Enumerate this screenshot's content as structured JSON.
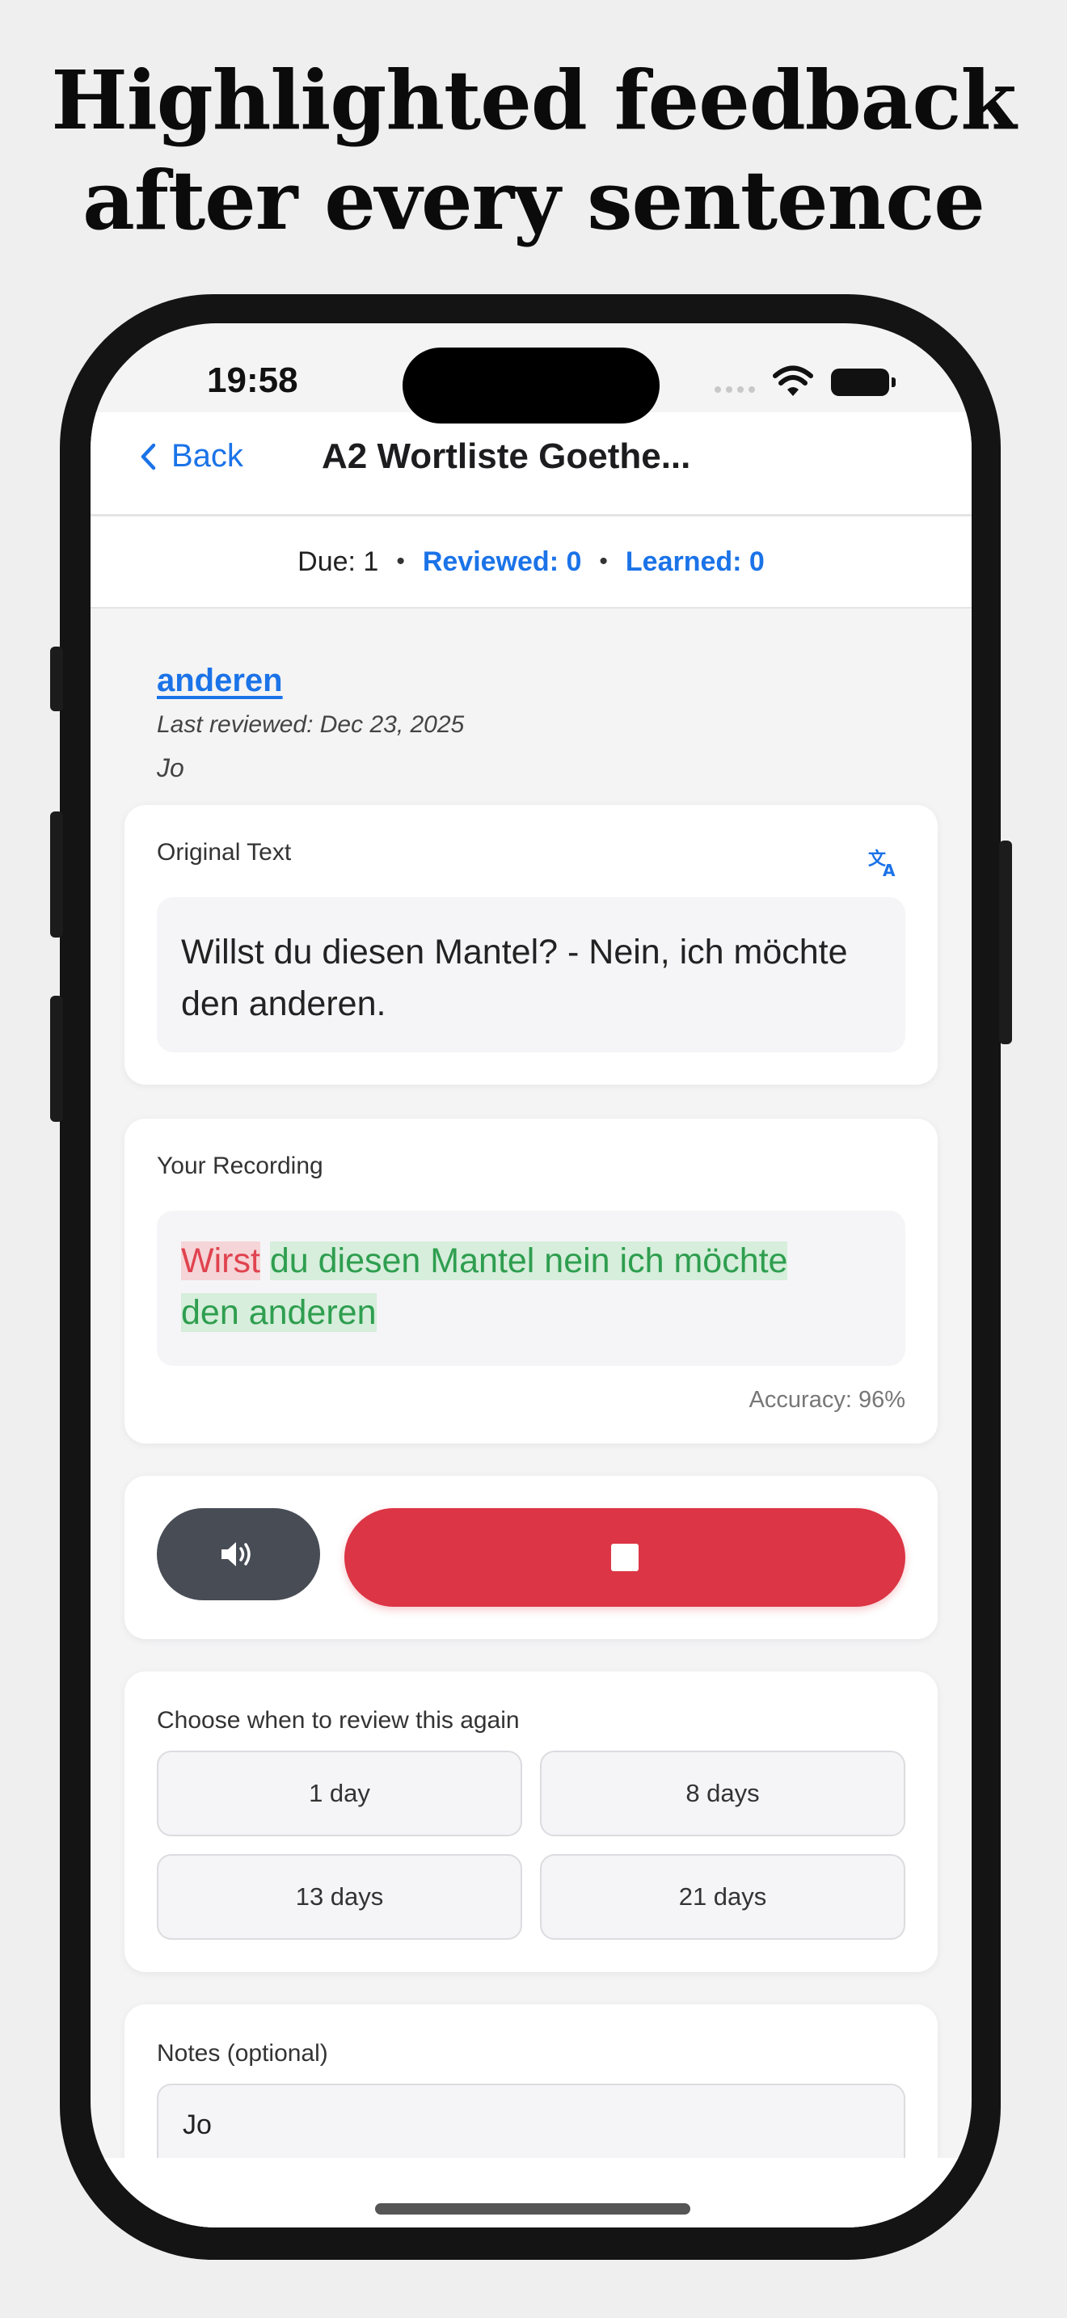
{
  "headline": {
    "line1": "Highlighted feedback",
    "line2": "after every sentence"
  },
  "status_bar": {
    "time": "19:58"
  },
  "nav": {
    "back_label": "Back",
    "title": "A2 Wortliste Goethe..."
  },
  "stats": {
    "due": "Due: 1",
    "reviewed": "Reviewed: 0",
    "learned": "Learned: 0",
    "separator": "•"
  },
  "word": {
    "term": "anderen",
    "last_reviewed": "Last reviewed: Dec 23, 2025",
    "note": "Jo"
  },
  "original": {
    "label": "Original Text",
    "text": "Willst du diesen Mantel? - Nein, ich möchte den anderen."
  },
  "recording": {
    "label": "Your Recording",
    "wrong": "Wirst",
    "correct_line1": "du diesen Mantel nein ich möchte",
    "correct_line2": "den anderen",
    "accuracy": "Accuracy: 96%",
    "accuracy_value": 96,
    "highlight_colors": {
      "wrong": "#e0434f",
      "correct": "#2e9e4f"
    }
  },
  "controls": {
    "speaker_icon": "speaker-icon",
    "stop_icon": "stop-icon",
    "record_color": "#dc3545"
  },
  "review": {
    "label": "Choose when to review this again",
    "options": [
      "1 day",
      "8 days",
      "13 days",
      "21 days"
    ]
  },
  "notes": {
    "label": "Notes (optional)",
    "value": "Jo"
  },
  "colors": {
    "accent": "#1b73e8"
  }
}
